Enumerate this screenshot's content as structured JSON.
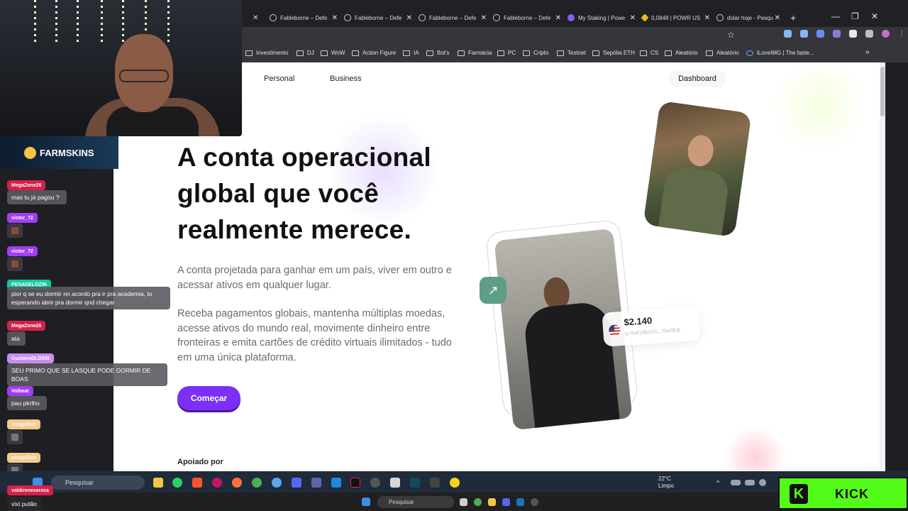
{
  "browser": {
    "tabs": [
      {
        "label": "Fableborne – Defe"
      },
      {
        "label": "Fableborne – Defe"
      },
      {
        "label": "Fableborne – Defe"
      },
      {
        "label": "Fableborne – Defe"
      },
      {
        "label": "My Staking | Powe"
      },
      {
        "label": "0,0848 | POWR US"
      },
      {
        "label": "dolar hoje - Pesqu"
      }
    ],
    "new_tab": "+",
    "bookmarks": [
      "Investimento",
      "DJ",
      "WoW",
      "Action Figure",
      "IA",
      "Bot's",
      "Farmácia",
      "PC",
      "Cripto",
      "Testnet",
      "Sepólia ETH",
      "CS",
      "Aleatório",
      "Aleatório",
      "iLoveIMG | The faste..."
    ],
    "bookmarks_more": "»"
  },
  "site": {
    "nav": {
      "personal": "Personal",
      "business": "Business",
      "dashboard": "Dashboard"
    },
    "hero": {
      "title": "A conta operacional global que você realmente merece.",
      "subtitle": "A conta projetada para ganhar em um país, viver em outro e acessar ativos em qualquer lugar.",
      "body": "Receba pagamentos globais, mantenha múltiplas moedas, acesse ativos do mundo real, movimente dinheiro entre fronteiras e emita cartões de crédito virtuais ilimitados - tudo em uma única plataforma.",
      "cta": "Começar"
    },
    "card": {
      "amount": "$2.140",
      "address": "to 0x818b163...7be0fcb"
    },
    "backed_by": "Apoiado por"
  },
  "stream": {
    "sponsor": "FARMSKINS",
    "chat": [
      {
        "user": "MegaZone26",
        "msg": "mas tu já pagou ?",
        "color": "#d6204b"
      },
      {
        "user": "victor_72",
        "msg": "",
        "color": "#a23cf5"
      },
      {
        "user": "victor_72",
        "msg": "",
        "color": "#a23cf5"
      },
      {
        "user": "PESADELOZIN",
        "msg": "pior q se eu dormir nn acordo pra ir pra academia, to esperando abrir pra dormir qnd chegar",
        "color": "#14c9a0"
      },
      {
        "user": "MegaZone26",
        "msg": "ata",
        "color": "#d6204b"
      },
      {
        "user": "GustavoDLD335",
        "msg": "SEU PRIMO QUE SE LASQUE PODE DORMIR DE BOAS",
        "color": "#c78df0"
      },
      {
        "user": "Volbeat",
        "msg": "pau pkrlho",
        "color": "#a23cf5"
      },
      {
        "user": "zerapelluh",
        "msg": "",
        "color": "#f7c98a"
      },
      {
        "user": "zerapelluh",
        "msg": "",
        "color": "#f7c98a"
      },
      {
        "user": "valdirenexereca",
        "msg": "vixi putão",
        "color": "#d6204b"
      }
    ],
    "kick_brand": "KICK"
  },
  "taskbar": {
    "search_placeholder": "Pesquisar",
    "weather_temp": "22°C",
    "weather_desc": "Limpo",
    "search2_placeholder": "Pesquisar"
  },
  "colors": {
    "accent": "#7b2ff7",
    "kick_green": "#53fc18",
    "badge_teal": "#5f9e86"
  }
}
